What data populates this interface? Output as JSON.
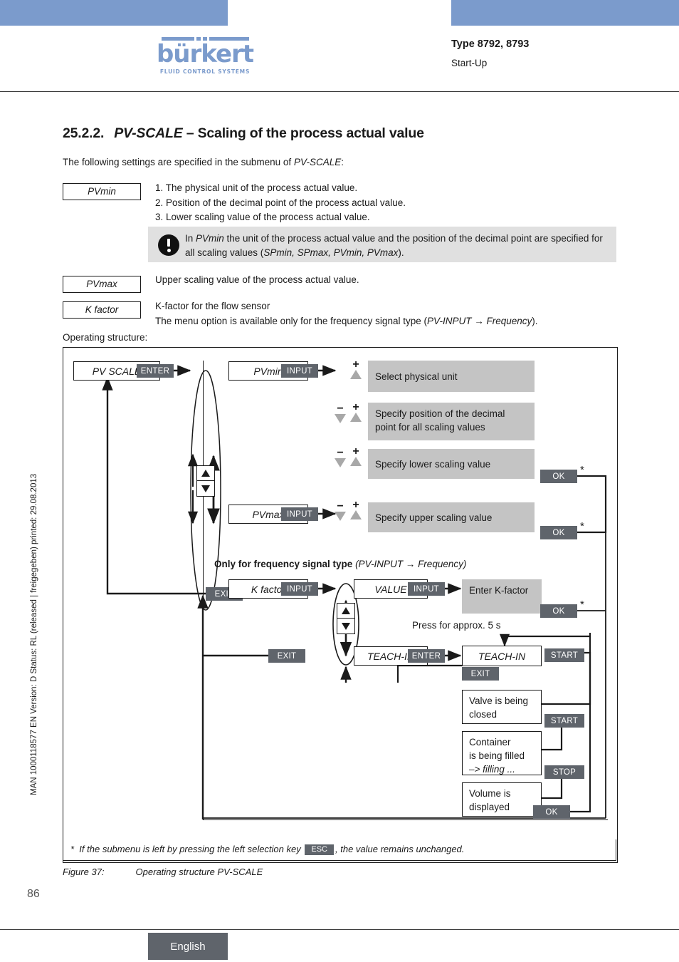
{
  "header": {
    "logo_word": "bürkert",
    "logo_sub": "FLUID CONTROL SYSTEMS",
    "type_line": "Type 8792, 8793",
    "sub_line": "Start-Up",
    "accent_blue": "#7b9bcc"
  },
  "sidebar": {
    "vertical_meta": "MAN 1000118577  EN  Version: D  Status: RL (released | freigegeben)  printed: 29.08.2013",
    "page_number": "86"
  },
  "section": {
    "number": "25.2.2.",
    "title_italic": "PV-SCALE",
    "title_rest": "– Scaling of the process actual value",
    "intro_pre": "The following settings are specified in the submenu of ",
    "intro_italic": "PV-SCALE",
    "intro_post": ":"
  },
  "tags": {
    "pvmin": "PVmin",
    "pvmax": "PVmax",
    "kfactor": "K factor"
  },
  "list_items": [
    "1. The physical unit of the process actual value.",
    "2. Position of the decimal point of the process actual value.",
    "3. Lower scaling value of the process actual value."
  ],
  "note": {
    "icon": "exclamation-circle-icon",
    "pre": "In ",
    "italic1": "PVmin",
    "mid": " the unit of the process actual value and the position of the decimal point are specified for all scaling values (",
    "italic2": "SPmin, SPmax, PVmin, PVmax",
    "post": ")."
  },
  "paragraphs": {
    "upper_scaling": "Upper scaling value of the process actual value.",
    "kfactor_l1": "K-factor for the flow sensor",
    "kfactor_l2_pre": "The menu option is available only for the frequency signal type (",
    "kfactor_l2_italic": "PV-INPUT → Frequency",
    "kfactor_l2_post": ").",
    "operating_structure": "Operating structure:"
  },
  "diagram": {
    "boxes": {
      "pv_scale": "PV SCALE",
      "pvmin": "PVmin",
      "pvmax": "PVmax",
      "k_factor": "K factor",
      "value": "VALUE",
      "teach_in": "TEACH-IN",
      "teach_in_2": "TEACH-IN"
    },
    "keys": {
      "enter": "ENTER",
      "enter2": "ENTER",
      "input1": "INPUT",
      "input2": "INPUT",
      "input3": "INPUT",
      "input4": "INPUT",
      "exit1": "EXIT",
      "exit2": "EXIT",
      "exit3": "EXIT",
      "ok1": "OK",
      "ok2": "OK",
      "ok3": "OK",
      "ok4": "OK",
      "start1": "START",
      "start2": "START",
      "stop": "STOP"
    },
    "descriptions": {
      "select_unit": "Select physical unit",
      "decimal_point": "Specify position of the decimal point for all scaling values",
      "lower_scaling": "Specify lower scaling value",
      "upper_scaling": "Specify upper scaling value",
      "enter_kfactor": "Enter K-factor"
    },
    "status_boxes": {
      "valve": "Valve is being closed",
      "container_l1": "Container",
      "container_l2": "is being filled",
      "container_l3": "–> filling ...",
      "volume": "Volume is displayed"
    },
    "labels": {
      "freq_bold": "Only for frequency signal type",
      "freq_italic": "(PV-INPUT → Frequency)",
      "press_for": "Press for approx. 5 s",
      "asterisk": "*"
    },
    "plus": "+",
    "minus": "−"
  },
  "footnote": {
    "star": "*",
    "pre": "If the submenu is left by pressing the left selection key",
    "key": "ESC",
    "post": ", the value remains unchanged."
  },
  "figure": {
    "label": "Figure 37:",
    "title": "Operating structure PV-SCALE"
  },
  "footer": {
    "language": "English"
  }
}
